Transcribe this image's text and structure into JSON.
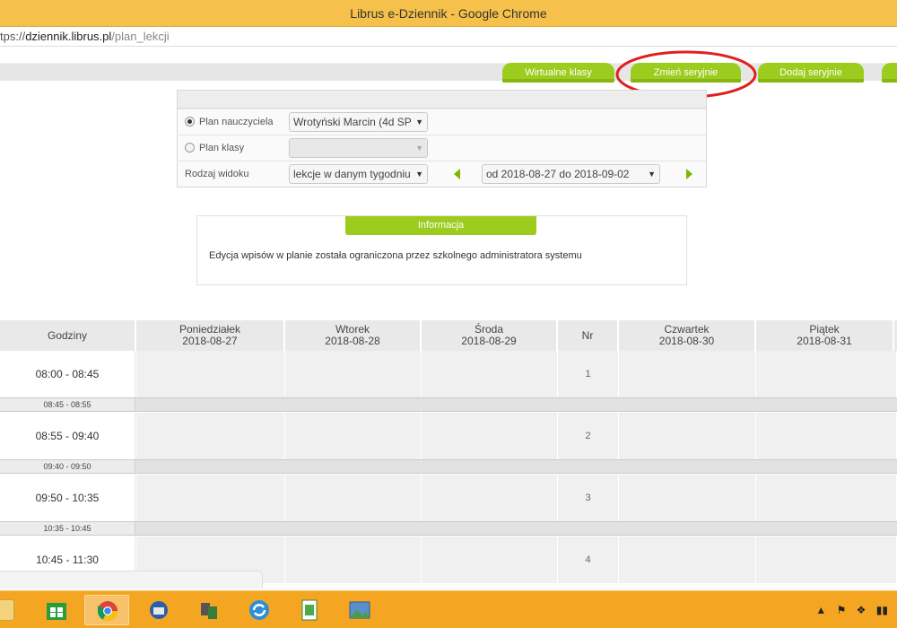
{
  "window": {
    "title": "Librus e-Dziennik - Google Chrome"
  },
  "address": {
    "scheme": "tps://",
    "host": "dziennik.librus.pl",
    "path": "/plan_lekcji"
  },
  "tabs": [
    {
      "label": "Wirtualne klasy"
    },
    {
      "label": "Zmień seryjnie",
      "highlighted": true
    },
    {
      "label": "Dodaj seryjnie"
    }
  ],
  "filters": {
    "plan_nauczyciela": {
      "label": "Plan nauczyciela",
      "selected": true,
      "value": "Wrotyński Marcin (4d SP"
    },
    "plan_klasy": {
      "label": "Plan klasy",
      "selected": false,
      "value": ""
    },
    "rodzaj_widoku": {
      "label": "Rodzaj widoku",
      "value": "lekcje w danym tygodniu",
      "range": "od 2018-08-27 do 2018-09-02"
    }
  },
  "info": {
    "title": "Informacja",
    "message": "Edycja wpisów w planie została ograniczona przez szkolnego administratora systemu"
  },
  "timetable": {
    "hours_header": "Godziny",
    "nr_header": "Nr",
    "days": [
      {
        "name": "Poniedziałek",
        "date": "2018-08-27"
      },
      {
        "name": "Wtorek",
        "date": "2018-08-28"
      },
      {
        "name": "Środa",
        "date": "2018-08-29"
      },
      {
        "name": "Czwartek",
        "date": "2018-08-30"
      },
      {
        "name": "Piątek",
        "date": "2018-08-31"
      }
    ],
    "lessons": [
      {
        "time": "08:00 - 08:45",
        "nr": "1"
      },
      {
        "time": "08:55 - 09:40",
        "nr": "2"
      },
      {
        "time": "09:50 - 10:35",
        "nr": "3"
      },
      {
        "time": "10:45 - 11:30",
        "nr": "4"
      }
    ],
    "breaks": [
      "08:45 - 08:55",
      "09:40 - 09:50",
      "10:35 - 10:45"
    ]
  },
  "colors": {
    "accent": "#9ccc1e",
    "titlebar": "#f6c14a",
    "taskbar": "#f4a623",
    "highlight_circle": "#e02020"
  },
  "taskbar": {
    "icons": [
      "file-explorer-icon",
      "store-icon",
      "chrome-icon",
      "thunderbird-icon",
      "network-icon",
      "sync-icon",
      "spreadsheet-icon",
      "photo-icon"
    ],
    "tray": [
      "flag-icon",
      "dropbox-icon",
      "network-status-icon"
    ]
  }
}
